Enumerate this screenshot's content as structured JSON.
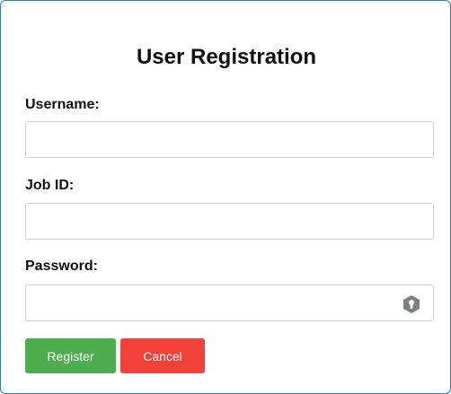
{
  "form": {
    "title": "User Registration",
    "fields": [
      {
        "label": "Username:",
        "value": "",
        "placeholder": ""
      },
      {
        "label": "Job ID:",
        "value": "",
        "placeholder": ""
      },
      {
        "label": "Password:",
        "value": "",
        "placeholder": ""
      }
    ],
    "password_icon": "key-lock-icon",
    "buttons": {
      "register_label": "Register",
      "cancel_label": "Cancel"
    }
  },
  "colors": {
    "border_accent": "#2f7fbf",
    "register": "#4cae4f",
    "cancel": "#f2413a",
    "lock_icon": "#7b7f85"
  }
}
